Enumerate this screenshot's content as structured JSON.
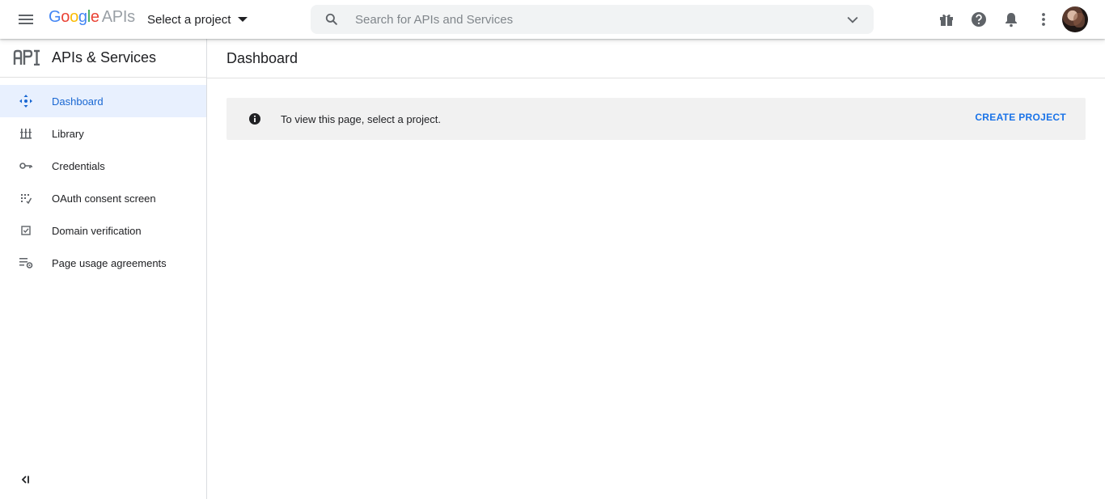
{
  "header": {
    "logo_google": [
      "G",
      "o",
      "o",
      "g",
      "l",
      "e"
    ],
    "logo_apis": "APIs",
    "project_select_label": "Select a project",
    "search": {
      "placeholder": "Search for APIs and Services",
      "value": ""
    },
    "icons": [
      "menu-icon",
      "search-icon",
      "chevron-down-icon",
      "gift-icon",
      "help-icon",
      "notifications-icon",
      "more-vert-icon",
      "avatar"
    ]
  },
  "sidebar": {
    "title": "APIs & Services",
    "items": [
      {
        "label": "Dashboard",
        "icon": "dashboard-icon",
        "active": true
      },
      {
        "label": "Library",
        "icon": "library-icon",
        "active": false
      },
      {
        "label": "Credentials",
        "icon": "key-icon",
        "active": false
      },
      {
        "label": "OAuth consent screen",
        "icon": "oauth-consent-icon",
        "active": false
      },
      {
        "label": "Domain verification",
        "icon": "checkbox-icon",
        "active": false
      },
      {
        "label": "Page usage agreements",
        "icon": "list-settings-icon",
        "active": false
      }
    ]
  },
  "main": {
    "page_title": "Dashboard",
    "banner": {
      "message": "To view this page, select a project.",
      "action_label": "CREATE PROJECT"
    }
  },
  "colors": {
    "accent": "#1a73e8",
    "active_bg": "#e8f0fe",
    "banner_bg": "#f1f1f1"
  }
}
